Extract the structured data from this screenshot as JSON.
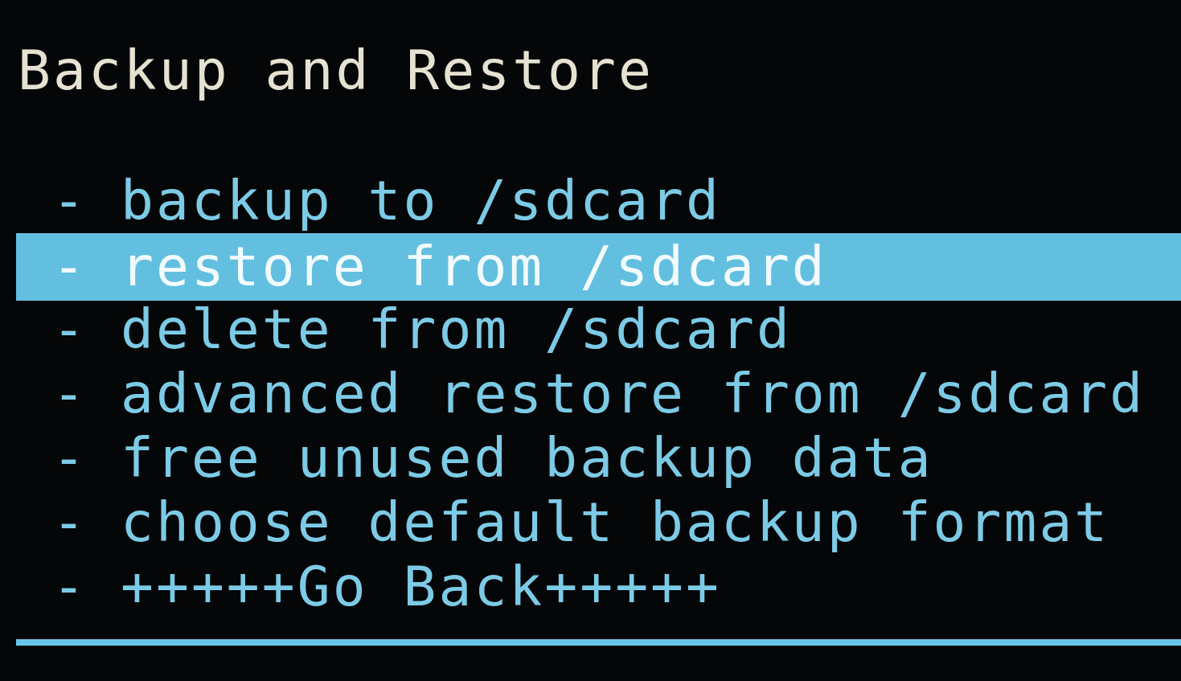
{
  "title": "Backup and Restore",
  "menu": [
    {
      "bullet": "-",
      "label": "backup to /sdcard",
      "selected": false
    },
    {
      "bullet": "-",
      "label": "restore from /sdcard",
      "selected": true
    },
    {
      "bullet": "-",
      "label": "delete from /sdcard",
      "selected": false
    },
    {
      "bullet": "-",
      "label": "advanced restore from /sdcard",
      "selected": false
    },
    {
      "bullet": "-",
      "label": "free unused backup data",
      "selected": false
    },
    {
      "bullet": "-",
      "label": "choose default backup format",
      "selected": false
    },
    {
      "bullet": "-",
      "label": "+++++Go Back+++++",
      "selected": false
    }
  ]
}
